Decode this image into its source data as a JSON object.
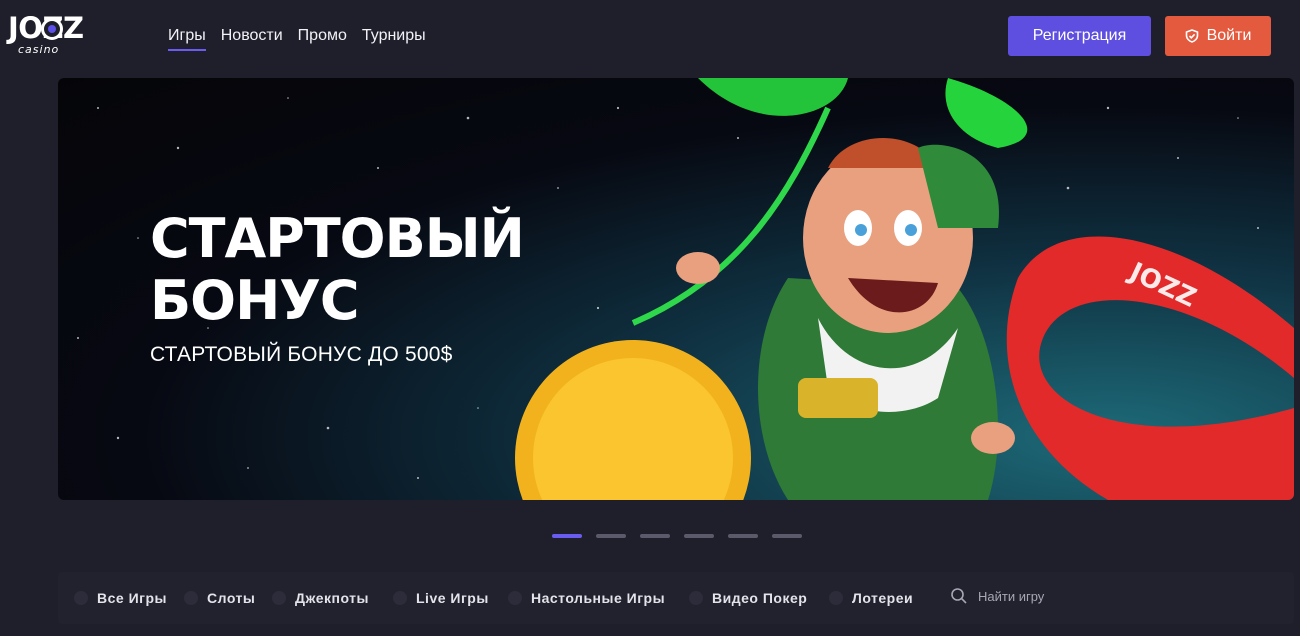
{
  "brand": {
    "name": "JOZZ",
    "sub": "casino"
  },
  "nav": {
    "items": [
      {
        "label": "Игры",
        "active": true
      },
      {
        "label": "Новости",
        "active": false
      },
      {
        "label": "Промо",
        "active": false
      },
      {
        "label": "Турниры",
        "active": false
      }
    ]
  },
  "header": {
    "register_label": "Регистрация",
    "login_label": "Войти",
    "login_icon": "shield-icon"
  },
  "banner": {
    "title_line1": "СТАРТОВЫЙ",
    "title_line2": "БОНУС",
    "subtitle": "СТАРТОВЫЙ БОНУС ДО 500$",
    "ribbon_text": "JOZZ"
  },
  "carousel": {
    "slides": 6,
    "active_index": 0
  },
  "categories": [
    {
      "label": "Все Игры",
      "icon": "all-games-icon"
    },
    {
      "label": "Слоты",
      "icon": "slots-icon"
    },
    {
      "label": "Джекпоты",
      "icon": "jackpot-icon"
    },
    {
      "label": "Live Игры",
      "icon": "live-games-icon"
    },
    {
      "label": "Настольные Игры",
      "icon": "table-games-icon"
    },
    {
      "label": "Видео Покер",
      "icon": "video-poker-icon"
    },
    {
      "label": "Лотереи",
      "icon": "lottery-icon"
    }
  ],
  "search": {
    "placeholder": "Найти игру",
    "value": ""
  },
  "colors": {
    "background": "#1f1f2b",
    "accent": "#5f4fe0",
    "login": "#e45a3f"
  }
}
